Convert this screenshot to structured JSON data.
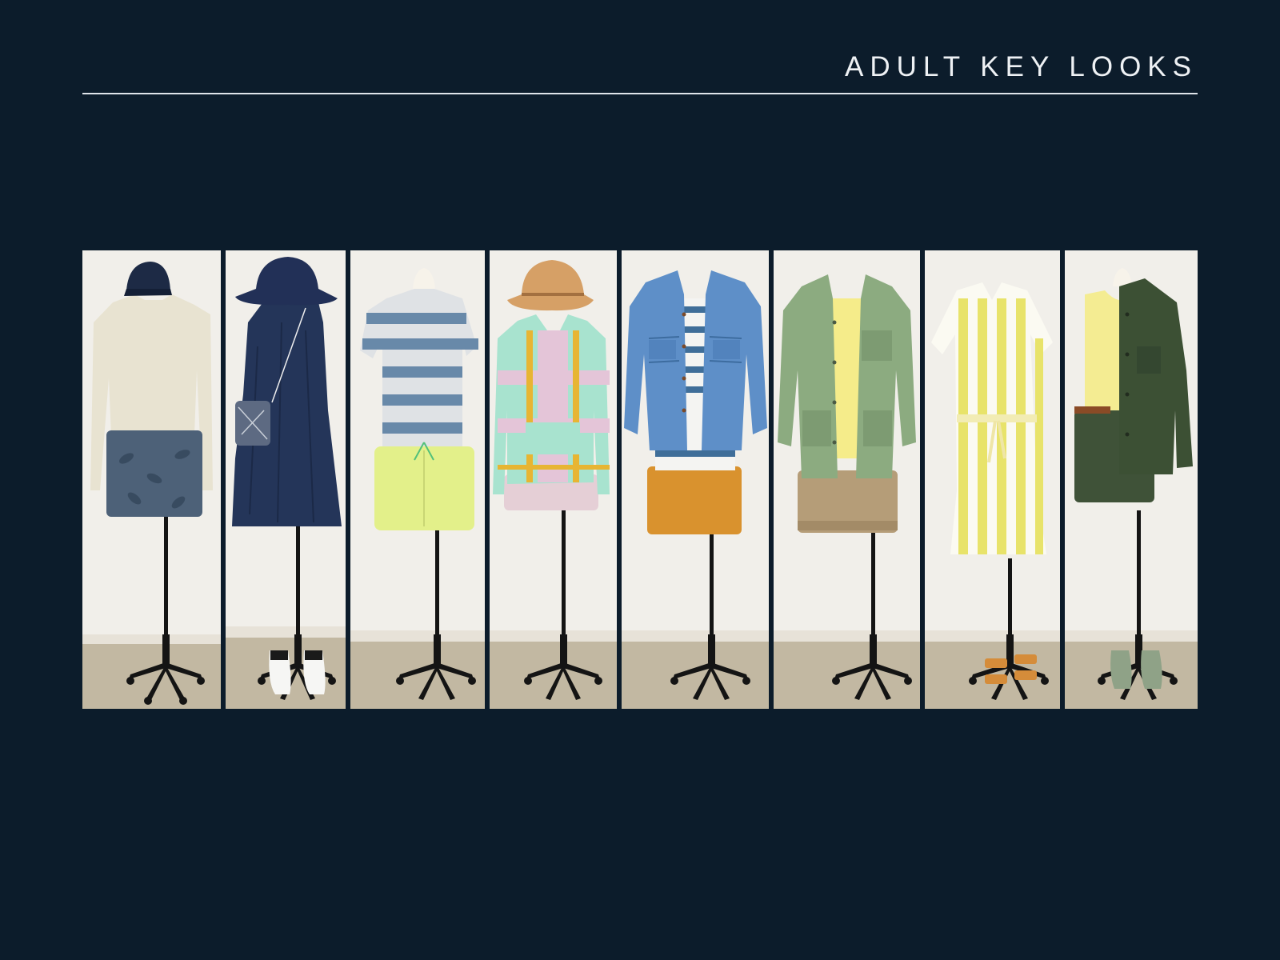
{
  "header": {
    "title": "ADULT KEY LOOKS"
  },
  "colors": {
    "background": "#0c1c2b",
    "title_text": "#eef1f4",
    "rule": "#dfe4ea",
    "wall": "#f1efea",
    "floor": "#c2b8a2",
    "stand": "#141414"
  },
  "looks": [
    {
      "name": "look-1",
      "items": [
        "navy-cap",
        "cream-long-sleeve-tee",
        "navy-leaf-print-shorts"
      ]
    },
    {
      "name": "look-2",
      "items": [
        "navy-bucket-hat",
        "navy-linen-halter-dress",
        "crossbody-pouch",
        "white-espadrilles"
      ]
    },
    {
      "name": "look-3",
      "items": [
        "blue-striped-tee",
        "lime-shorts"
      ]
    },
    {
      "name": "look-4",
      "items": [
        "straw-hat",
        "pastel-striped-poncho-hoodie",
        "lilac-shorts"
      ]
    },
    {
      "name": "look-5",
      "items": [
        "denim-jacket",
        "striped-tee",
        "ochre-shorts"
      ]
    },
    {
      "name": "look-6",
      "items": [
        "sage-utility-jacket",
        "yellow-tee",
        "khaki-shorts"
      ]
    },
    {
      "name": "look-7",
      "items": [
        "yellow-striped-shirt-dress",
        "tan-sandals"
      ]
    },
    {
      "name": "look-8",
      "items": [
        "yellow-tank",
        "olive-overshirt",
        "olive-shorts",
        "brown-belt",
        "green-slip-ons"
      ]
    }
  ]
}
